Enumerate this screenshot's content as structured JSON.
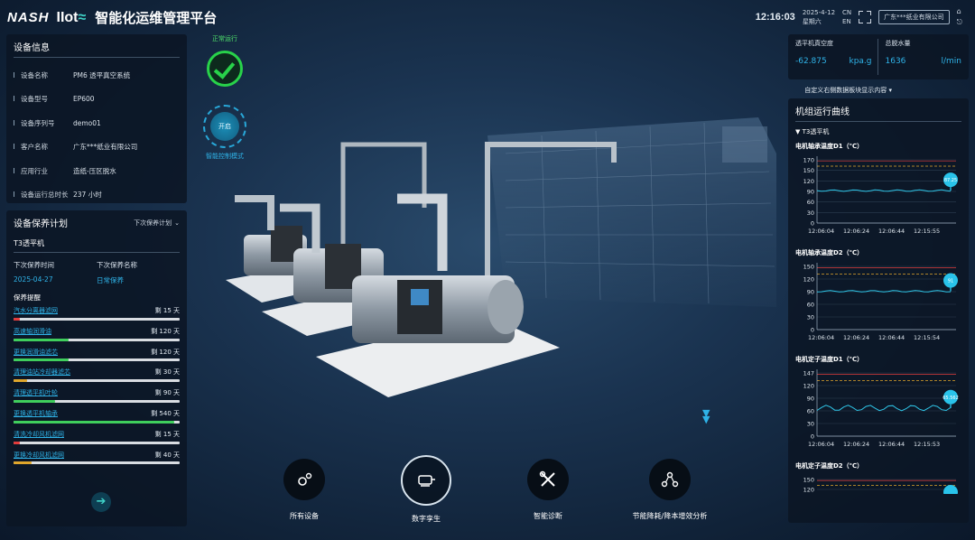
{
  "header": {
    "brand_nash": "NASH",
    "brand_iiot": "IIot",
    "brand_wave": "≈",
    "title": "智能化运维管理平台",
    "time": "12:16:03",
    "date": "2025-4-12",
    "weekday": "星期六",
    "lang_cn": "CN",
    "lang_en": "EN",
    "company": "广东***纸业有限公司",
    "home_icon": "⌂",
    "logout_icon": "⎋"
  },
  "device_info": {
    "title": "设备信息",
    "rows": [
      {
        "label": "设备名称",
        "value": "PM6 透平真空系统"
      },
      {
        "label": "设备型号",
        "value": "EP600"
      },
      {
        "label": "设备序列号",
        "value": "demo01"
      },
      {
        "label": "客户名称",
        "value": "广东***纸业有限公司"
      },
      {
        "label": "应用行业",
        "value": "造纸-压区脱水"
      },
      {
        "label": "设备运行总时长",
        "value": "237 小时"
      }
    ]
  },
  "maintenance": {
    "title": "设备保养计划",
    "select_label": "下次保养计划",
    "machine": "T3透平机",
    "next_time_label": "下次保养时间",
    "next_time_value": "2025-04-27",
    "next_name_label": "下次保养名称",
    "next_name_value": "日常保养",
    "reminder_title": "保养提醒",
    "tasks": [
      {
        "name": "汽水分离器滤网",
        "days": "剩 15 天",
        "progress": 0.04,
        "color": "#e23b3b"
      },
      {
        "name": "高速轴润滑油",
        "days": "剩 120 天",
        "progress": 0.33,
        "color": "#3fce5c"
      },
      {
        "name": "更换润滑油滤芯",
        "days": "剩 120 天",
        "progress": 0.33,
        "color": "#3fce5c"
      },
      {
        "name": "清理油站冷却器滤芯",
        "days": "剩 30 天",
        "progress": 0.08,
        "color": "#e0a62b"
      },
      {
        "name": "清理透平机叶轮",
        "days": "剩 90 天",
        "progress": 0.25,
        "color": "#3fce5c"
      },
      {
        "name": "更换透平机轴承",
        "days": "剩 540 天",
        "progress": 0.97,
        "color": "#3fce5c"
      },
      {
        "name": "清洗冷却风机滤网",
        "days": "剩 15 天",
        "progress": 0.04,
        "color": "#e23b3b"
      },
      {
        "name": "更换冷却风机滤网",
        "days": "剩 40 天",
        "progress": 0.11,
        "color": "#e0a62b"
      }
    ]
  },
  "status": {
    "running_label": "正常运行",
    "power_label": "开启",
    "mode_label": "智能控制模式"
  },
  "kpi": {
    "vacuum_label": "透平机真空度",
    "vacuum_value": "-62.875",
    "vacuum_unit": "kpa.g",
    "water_label": "总脱水量",
    "water_value": "1636",
    "water_unit": "l/min"
  },
  "custom_link": "自定义右侧数据板块显示内容 ▾",
  "curves": {
    "title": "机组运行曲线",
    "machine": "▼ T3透平机",
    "charts": [
      {
        "title": "电机轴承温度D1（℃）",
        "yticks": [
          "170",
          "150",
          "120",
          "90",
          "60",
          "30",
          "0"
        ],
        "xticks": [
          "12:06:04",
          "12:06:24",
          "12:06:44",
          "12:15:55"
        ],
        "marker": "87.25"
      },
      {
        "title": "电机轴承温度D2（℃）",
        "yticks": [
          "150",
          "120",
          "90",
          "60",
          "30",
          "0"
        ],
        "xticks": [
          "12:06:04",
          "12:06:24",
          "12:06:44",
          "12:15:54"
        ],
        "marker": "91"
      },
      {
        "title": "电机定子温度D1（℃）",
        "yticks": [
          "147",
          "120",
          "90",
          "60",
          "30",
          "0"
        ],
        "xticks": [
          "12:06:04",
          "12:06:24",
          "12:06:44",
          "12:15:53"
        ],
        "marker": "65.562"
      },
      {
        "title": "电机定子温度D2（℃）",
        "yticks": [
          "150",
          "120"
        ],
        "xticks": [],
        "marker": ""
      }
    ]
  },
  "nav": [
    {
      "label": "所有设备",
      "icon": "gear-icon"
    },
    {
      "label": "数字孪生",
      "icon": "pump-icon"
    },
    {
      "label": "智能诊断",
      "icon": "tools-icon"
    },
    {
      "label": "节能降耗/降本增效分析",
      "icon": "nodes-icon"
    }
  ],
  "colors": {
    "accent": "#2fb3e8",
    "ok": "#28d24a",
    "warn": "#e0a62b",
    "alarm": "#e23b3b",
    "panel": "#0b1624"
  }
}
